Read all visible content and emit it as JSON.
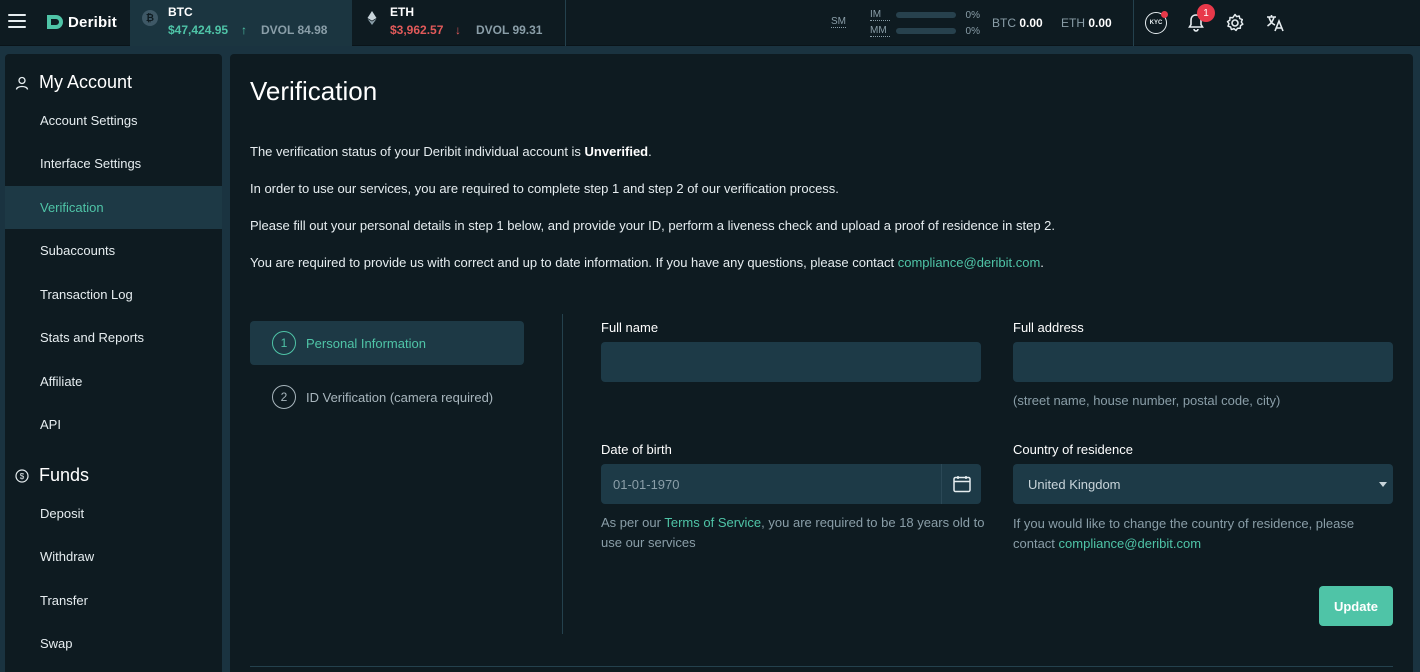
{
  "topbar": {
    "logo_text": "Deribit",
    "tickers": [
      {
        "symbol": "BTC",
        "price": "$47,424.95",
        "direction": "up",
        "arrow": "↑",
        "dvol": "DVOL 84.98"
      },
      {
        "symbol": "ETH",
        "price": "$3,962.57",
        "direction": "down",
        "arrow": "↓",
        "dvol": "DVOL 99.31"
      }
    ],
    "sm_label": "SM",
    "im_label": "IM",
    "im_pct": "0%",
    "mm_label": "MM",
    "mm_pct": "0%",
    "balances": [
      {
        "sym": "BTC",
        "value": "0.00"
      },
      {
        "sym": "ETH",
        "value": "0.00"
      }
    ],
    "kyc_label": "KYC",
    "notification_count": "1"
  },
  "sidebar": {
    "account_heading": "My Account",
    "account_items": [
      {
        "label": "Account Settings",
        "active": false
      },
      {
        "label": "Interface Settings",
        "active": false
      },
      {
        "label": "Verification",
        "active": true
      },
      {
        "label": "Subaccounts",
        "active": false
      },
      {
        "label": "Transaction Log",
        "active": false
      },
      {
        "label": "Stats and Reports",
        "active": false
      },
      {
        "label": "Affiliate",
        "active": false
      },
      {
        "label": "API",
        "active": false
      }
    ],
    "funds_heading": "Funds",
    "funds_items": [
      {
        "label": "Deposit"
      },
      {
        "label": "Withdraw"
      },
      {
        "label": "Transfer"
      },
      {
        "label": "Swap"
      }
    ]
  },
  "main": {
    "title": "Verification",
    "status_prefix": "The verification status of your Deribit individual account is ",
    "status_value": "Unverified",
    "status_suffix": ".",
    "para2": "In order to use our services, you are required to complete step 1 and step 2 of our verification process.",
    "para3": "Please fill out your personal details in step 1 below, and provide your ID, perform a liveness check and upload a proof of residence in step 2.",
    "para4_prefix": "You are required to provide us with correct and up to date information. If you have any questions, please contact ",
    "contact_email": "compliance@deribit.com",
    "para4_suffix": ".",
    "steps": [
      {
        "num": "1",
        "label": "Personal Information",
        "active": true
      },
      {
        "num": "2",
        "label": "ID Verification (camera required)",
        "active": false
      }
    ],
    "form": {
      "full_name_label": "Full name",
      "full_name_value": "",
      "full_address_label": "Full address",
      "full_address_value": "",
      "address_hint": "(street name, house number, postal code, city)",
      "dob_label": "Date of birth",
      "dob_placeholder": "01-01-1970",
      "dob_hint_prefix": "As per our ",
      "dob_hint_link": "Terms of Service",
      "dob_hint_line1_suffix": ", you are required to be 18 years old to",
      "dob_hint_line2": "use our services",
      "country_label": "Country of residence",
      "country_value": "United Kingdom",
      "country_hint_line1": "If you would like to change the country of residence, please",
      "country_hint_prefix2": "contact ",
      "country_hint_email": "compliance@deribit.com",
      "update_label": "Update"
    }
  }
}
